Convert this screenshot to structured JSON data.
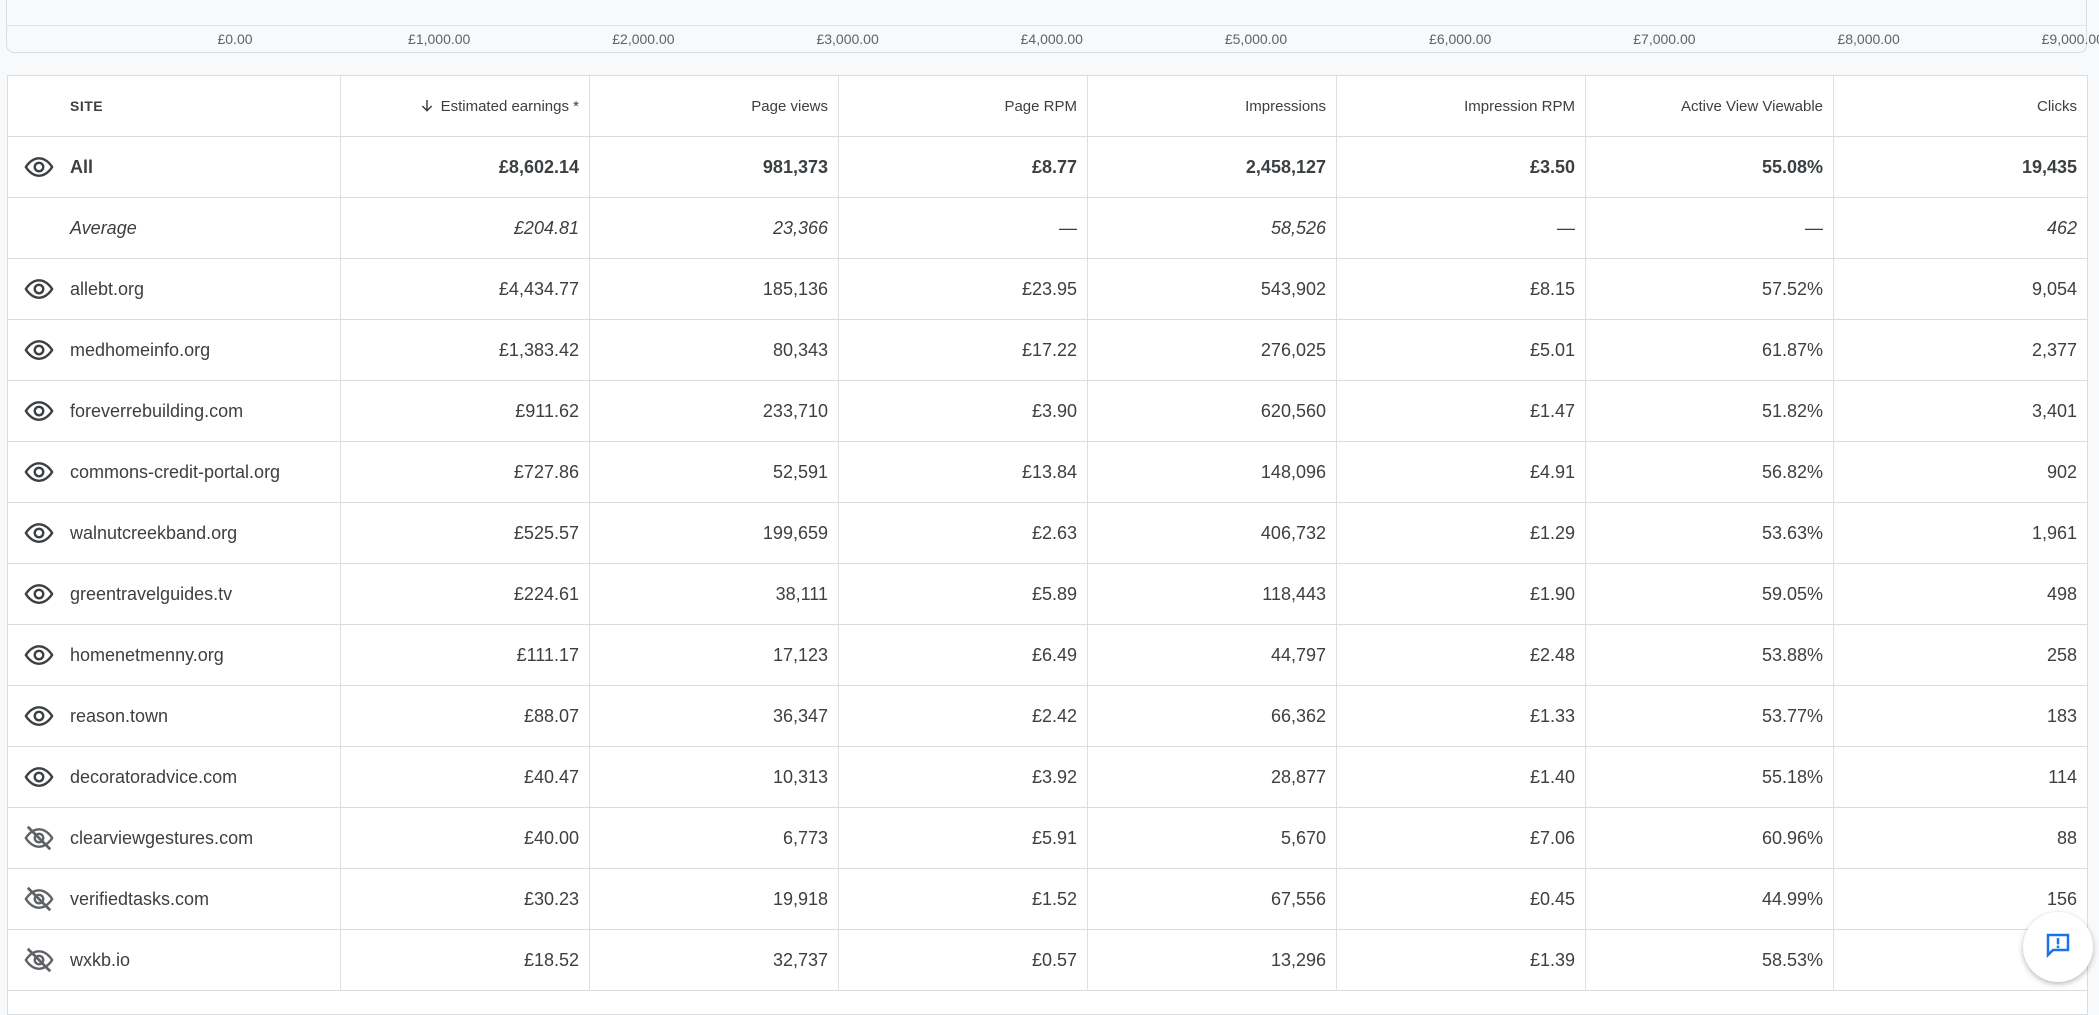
{
  "chart": {
    "x_ticks": [
      "£0.00",
      "£1,000.00",
      "£2,000.00",
      "£3,000.00",
      "£4,000.00",
      "£5,000.00",
      "£6,000.00",
      "£7,000.00",
      "£8,000.00",
      "£9,000.00"
    ]
  },
  "table": {
    "headers": {
      "site": "SITE",
      "earnings": "Estimated earnings *",
      "page_views": "Page views",
      "page_rpm": "Page RPM",
      "impressions": "Impressions",
      "impression_rpm": "Impression RPM",
      "active_view": "Active View Viewable",
      "clicks": "Clicks"
    },
    "sort_icon": "arrow-down-icon",
    "all_row": {
      "site": "All",
      "earnings": "£8,602.14",
      "page_views": "981,373",
      "page_rpm": "£8.77",
      "impressions": "2,458,127",
      "impression_rpm": "£3.50",
      "active_view": "55.08%",
      "clicks": "19,435",
      "icon": "eye-icon"
    },
    "average_row": {
      "site": "Average",
      "earnings": "£204.81",
      "page_views": "23,366",
      "page_rpm": "—",
      "impressions": "58,526",
      "impression_rpm": "—",
      "active_view": "—",
      "clicks": "462"
    },
    "rows": [
      {
        "site": "allebt.org",
        "earnings": "£4,434.77",
        "page_views": "185,136",
        "page_rpm": "£23.95",
        "impressions": "543,902",
        "impression_rpm": "£8.15",
        "active_view": "57.52%",
        "clicks": "9,054",
        "icon": "eye-icon"
      },
      {
        "site": "medhomeinfo.org",
        "earnings": "£1,383.42",
        "page_views": "80,343",
        "page_rpm": "£17.22",
        "impressions": "276,025",
        "impression_rpm": "£5.01",
        "active_view": "61.87%",
        "clicks": "2,377",
        "icon": "eye-icon"
      },
      {
        "site": "foreverrebuilding.com",
        "earnings": "£911.62",
        "page_views": "233,710",
        "page_rpm": "£3.90",
        "impressions": "620,560",
        "impression_rpm": "£1.47",
        "active_view": "51.82%",
        "clicks": "3,401",
        "icon": "eye-icon"
      },
      {
        "site": "commons-credit-portal.org",
        "earnings": "£727.86",
        "page_views": "52,591",
        "page_rpm": "£13.84",
        "impressions": "148,096",
        "impression_rpm": "£4.91",
        "active_view": "56.82%",
        "clicks": "902",
        "icon": "eye-icon"
      },
      {
        "site": "walnutcreekband.org",
        "earnings": "£525.57",
        "page_views": "199,659",
        "page_rpm": "£2.63",
        "impressions": "406,732",
        "impression_rpm": "£1.29",
        "active_view": "53.63%",
        "clicks": "1,961",
        "icon": "eye-icon"
      },
      {
        "site": "greentravelguides.tv",
        "earnings": "£224.61",
        "page_views": "38,111",
        "page_rpm": "£5.89",
        "impressions": "118,443",
        "impression_rpm": "£1.90",
        "active_view": "59.05%",
        "clicks": "498",
        "icon": "eye-icon"
      },
      {
        "site": "homenetmenny.org",
        "earnings": "£111.17",
        "page_views": "17,123",
        "page_rpm": "£6.49",
        "impressions": "44,797",
        "impression_rpm": "£2.48",
        "active_view": "53.88%",
        "clicks": "258",
        "icon": "eye-icon"
      },
      {
        "site": "reason.town",
        "earnings": "£88.07",
        "page_views": "36,347",
        "page_rpm": "£2.42",
        "impressions": "66,362",
        "impression_rpm": "£1.33",
        "active_view": "53.77%",
        "clicks": "183",
        "icon": "eye-icon"
      },
      {
        "site": "decoratoradvice.com",
        "earnings": "£40.47",
        "page_views": "10,313",
        "page_rpm": "£3.92",
        "impressions": "28,877",
        "impression_rpm": "£1.40",
        "active_view": "55.18%",
        "clicks": "114",
        "icon": "eye-icon"
      },
      {
        "site": "clearviewgestures.com",
        "earnings": "£40.00",
        "page_views": "6,773",
        "page_rpm": "£5.91",
        "impressions": "5,670",
        "impression_rpm": "£7.06",
        "active_view": "60.96%",
        "clicks": "88",
        "icon": "eye-off-icon"
      },
      {
        "site": "verifiedtasks.com",
        "earnings": "£30.23",
        "page_views": "19,918",
        "page_rpm": "£1.52",
        "impressions": "67,556",
        "impression_rpm": "£0.45",
        "active_view": "44.99%",
        "clicks": "156",
        "icon": "eye-off-icon"
      },
      {
        "site": "wxkb.io",
        "earnings": "£18.52",
        "page_views": "32,737",
        "page_rpm": "£0.57",
        "impressions": "13,296",
        "impression_rpm": "£1.39",
        "active_view": "58.53%",
        "clicks": "",
        "icon": "eye-off-icon"
      }
    ]
  },
  "feedback_button": {
    "icon": "feedback-icon"
  }
}
